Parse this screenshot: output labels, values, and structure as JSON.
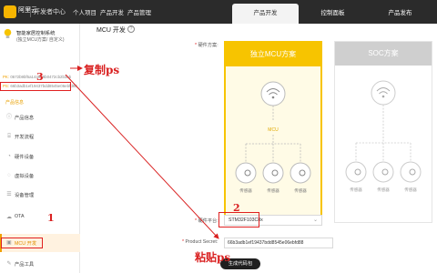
{
  "topbar": {
    "logo_text": "阿里云",
    "dev_center": "开发者中心",
    "nav": [
      "个人项目",
      "产品开发",
      "产品管理"
    ],
    "tabs": [
      "产品开发",
      "控制面板",
      "产品发布"
    ]
  },
  "sidebar": {
    "product_name": "智能家居控制系统",
    "product_sub": "(独立MCU方案/ 自定义)",
    "meta": [
      {
        "label": "PK:",
        "value": "0672b9bf5a1446b8b0472cb2b3ab"
      },
      {
        "label": "PS:",
        "value": "66b3adb1ef19437bdd8545e06ebfd88"
      }
    ],
    "section_title": "产品信息",
    "items": [
      {
        "icon": "info-icon",
        "label": "产品信息"
      },
      {
        "icon": "code-icon",
        "label": "开发流程"
      },
      {
        "icon": "chart-icon",
        "label": "硬件设备"
      },
      {
        "icon": "link-icon",
        "label": "虚拟设备"
      },
      {
        "icon": "list-icon",
        "label": "设备管理"
      },
      {
        "icon": "cloud-icon",
        "label": "OTA"
      },
      {
        "icon": "chip-icon",
        "label": "MCU 开发"
      },
      {
        "icon": "tool-icon",
        "label": "产品工具"
      }
    ]
  },
  "main": {
    "title": "MCU 开发",
    "hardware_scheme_label": "硬件方案:",
    "schemes": [
      {
        "name": "独立MCU方案",
        "selected": true,
        "chip_label": "MCU",
        "node_labels": [
          "传感器",
          "传感器",
          "传感器"
        ]
      },
      {
        "name": "SOC方案",
        "selected": false,
        "node_labels": [
          "传感器",
          "传感器",
          "传感器"
        ]
      }
    ],
    "platform_label": "硬件平台:",
    "platform_value": "STM32F103C8x",
    "secret_label": "Product Secret:",
    "secret_value": "66b3adb1ef19437bdd8545e06ebfd88",
    "generate_button": "生成代码包"
  },
  "annotations": {
    "copy_ps": "复制ps",
    "paste_ps": "粘贴ps",
    "step1": "1",
    "step2": "2",
    "step3": "3",
    "color": "#d92020"
  },
  "colors": {
    "accent": "#f7c400",
    "topbar": "#2b2b2b",
    "annotation": "#d92020"
  }
}
